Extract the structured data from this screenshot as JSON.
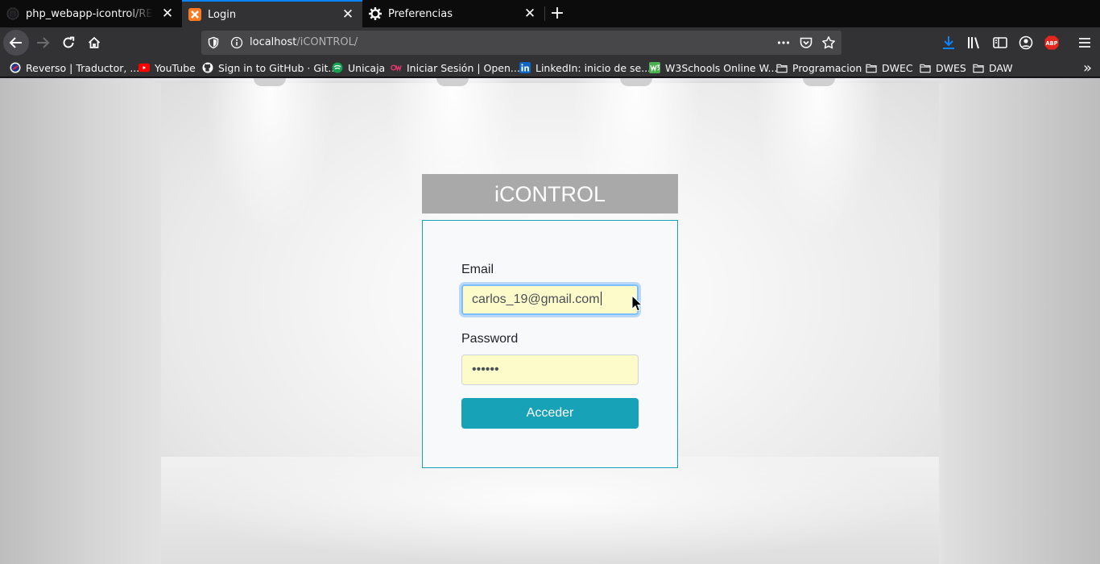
{
  "browser": {
    "tabs": [
      {
        "title": "php_webapp-icontrol/README.md",
        "icon": "github-icon",
        "active": false
      },
      {
        "title": "Login",
        "icon": "xampp-icon",
        "active": true
      },
      {
        "title": "Preferencias",
        "icon": "gear-icon",
        "active": false
      }
    ],
    "new_tab_label": "+",
    "url": {
      "host": "localhost",
      "path": "/iCONTROL/"
    },
    "bookmarks": [
      {
        "label": "Reverso | Traductor, ...",
        "icon": "reverso-icon"
      },
      {
        "label": "YouTube",
        "icon": "youtube-icon"
      },
      {
        "label": "Sign in to GitHub · Git...",
        "icon": "github-icon"
      },
      {
        "label": "Unicaja",
        "icon": "unicaja-icon"
      },
      {
        "label": "Iniciar Sesión | Open...",
        "icon": "openwebinars-icon"
      },
      {
        "label": "LinkedIn: inicio de se...",
        "icon": "linkedin-icon"
      },
      {
        "label": "W3Schools Online W...",
        "icon": "w3schools-icon"
      },
      {
        "label": "Programacion",
        "icon": "folder-icon"
      },
      {
        "label": "DWEC",
        "icon": "folder-icon"
      },
      {
        "label": "DWES",
        "icon": "folder-icon"
      },
      {
        "label": "DAW",
        "icon": "folder-icon"
      }
    ],
    "colors": {
      "accent": "#0a84ff",
      "chrome": "#323234",
      "tabstrip": "#0c0c0d"
    }
  },
  "login": {
    "brand": "iCONTROL",
    "email_label": "Email",
    "email_value": "carlos_19@gmail.com",
    "password_label": "Password",
    "password_value": "••••••",
    "submit_label": "Acceder",
    "colors": {
      "primary": "#17a2b8",
      "input_bg": "#fefbca",
      "brand_bg": "#a9a9a9"
    }
  }
}
